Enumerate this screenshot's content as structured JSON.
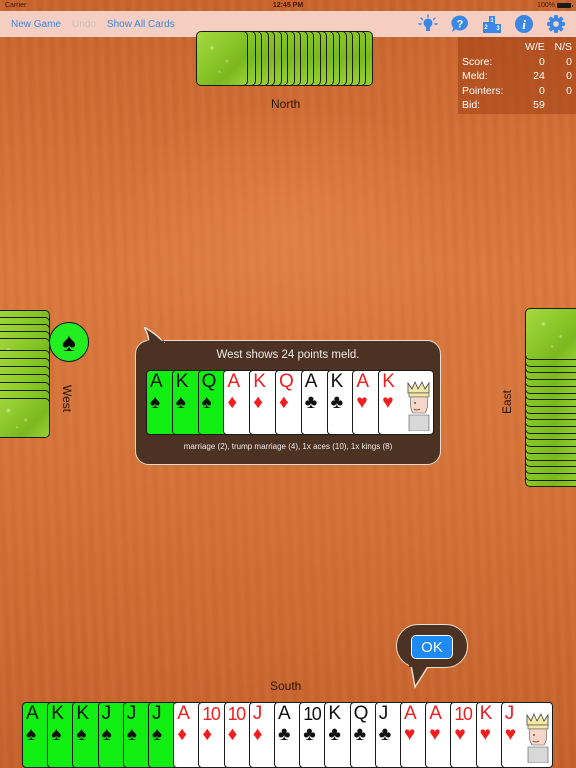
{
  "status_bar": {
    "carrier": "Carrier",
    "time": "12:45 PM",
    "battery": "100%"
  },
  "toolbar": {
    "new_game_label": "New Game",
    "undo_label": "Undo",
    "show_all_cards_label": "Show All Cards",
    "icons": [
      "hint-lightbulb-icon",
      "help-icon",
      "leaderboard-icon",
      "info-icon",
      "settings-gear-icon"
    ],
    "accent_color": "#3b87e6"
  },
  "score_panel": {
    "columns": [
      "W/E",
      "N/S"
    ],
    "rows": [
      {
        "label": "Score:",
        "we": "0",
        "ns": "0"
      },
      {
        "label": "Meld:",
        "we": "24",
        "ns": "0"
      },
      {
        "label": "Pointers:",
        "we": "0",
        "ns": "0"
      },
      {
        "label": "Bid:",
        "we": "59",
        "ns": ""
      }
    ]
  },
  "seats": {
    "north": "North",
    "south": "South",
    "west": "West",
    "east": "East"
  },
  "trump_suit": {
    "suit": "spades",
    "symbol": "♠",
    "color": "#22ee22"
  },
  "opponent_card_counts": {
    "north": 20,
    "west": 12,
    "east": 20
  },
  "meld_bubble": {
    "title": "West shows 24 points meld.",
    "cards": [
      {
        "rank": "A",
        "suit": "♠",
        "color": "black",
        "trump": true
      },
      {
        "rank": "K",
        "suit": "♠",
        "color": "black",
        "trump": true
      },
      {
        "rank": "Q",
        "suit": "♠",
        "color": "black",
        "trump": true
      },
      {
        "rank": "A",
        "suit": "♦",
        "color": "red",
        "trump": false
      },
      {
        "rank": "K",
        "suit": "♦",
        "color": "red",
        "trump": false
      },
      {
        "rank": "Q",
        "suit": "♦",
        "color": "red",
        "trump": false
      },
      {
        "rank": "A",
        "suit": "♣",
        "color": "black",
        "trump": false
      },
      {
        "rank": "K",
        "suit": "♣",
        "color": "black",
        "trump": false
      },
      {
        "rank": "A",
        "suit": "♥",
        "color": "red",
        "trump": false
      },
      {
        "rank": "K",
        "suit": "♥",
        "color": "red",
        "trump": false,
        "face": true
      }
    ],
    "description": "marriage (2), trump marriage (4), 1x aces (10), 1x kings (8)"
  },
  "ok_button_label": "OK",
  "south_hand": [
    {
      "rank": "A",
      "suit": "♠",
      "color": "black",
      "trump": true
    },
    {
      "rank": "K",
      "suit": "♠",
      "color": "black",
      "trump": true
    },
    {
      "rank": "K",
      "suit": "♠",
      "color": "black",
      "trump": true
    },
    {
      "rank": "J",
      "suit": "♠",
      "color": "black",
      "trump": true
    },
    {
      "rank": "J",
      "suit": "♠",
      "color": "black",
      "trump": true
    },
    {
      "rank": "J",
      "suit": "♠",
      "color": "black",
      "trump": true
    },
    {
      "rank": "A",
      "suit": "♦",
      "color": "red",
      "trump": false
    },
    {
      "rank": "10",
      "suit": "♦",
      "color": "red",
      "trump": false
    },
    {
      "rank": "10",
      "suit": "♦",
      "color": "red",
      "trump": false
    },
    {
      "rank": "J",
      "suit": "♦",
      "color": "red",
      "trump": false
    },
    {
      "rank": "A",
      "suit": "♣",
      "color": "black",
      "trump": false
    },
    {
      "rank": "10",
      "suit": "♣",
      "color": "black",
      "trump": false
    },
    {
      "rank": "K",
      "suit": "♣",
      "color": "black",
      "trump": false
    },
    {
      "rank": "Q",
      "suit": "♣",
      "color": "black",
      "trump": false
    },
    {
      "rank": "J",
      "suit": "♣",
      "color": "black",
      "trump": false
    },
    {
      "rank": "A",
      "suit": "♥",
      "color": "red",
      "trump": false
    },
    {
      "rank": "A",
      "suit": "♥",
      "color": "red",
      "trump": false
    },
    {
      "rank": "10",
      "suit": "♥",
      "color": "red",
      "trump": false
    },
    {
      "rank": "K",
      "suit": "♥",
      "color": "red",
      "trump": false
    },
    {
      "rank": "J",
      "suit": "♥",
      "color": "red",
      "trump": false,
      "face": true
    }
  ]
}
